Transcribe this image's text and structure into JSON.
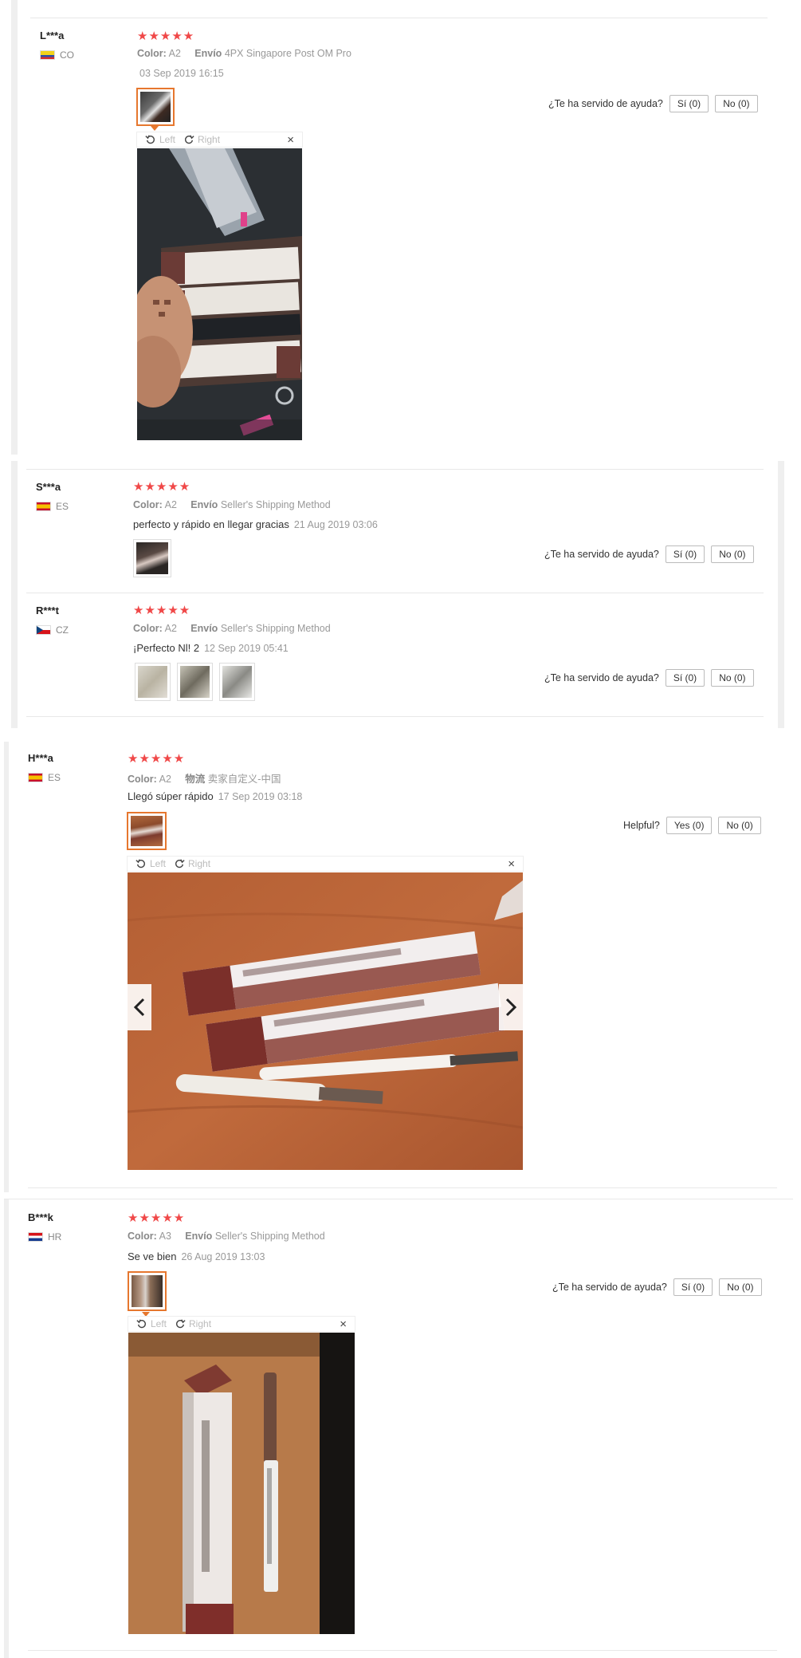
{
  "reviews": [
    {
      "user": "L***a",
      "country": "CO",
      "stars": "★★★★★",
      "color_label": "Color:",
      "color_value": "A2",
      "ship_label": "Envío",
      "ship_value": "4PX Singapore Post OM Pro",
      "date": "03 Sep 2019 16:15",
      "helpful_q": "¿Te ha servido de ayuda?",
      "yes": "Sí (0)",
      "no": "No (0)"
    },
    {
      "user": "S***a",
      "country": "ES",
      "stars": "★★★★★",
      "color_label": "Color:",
      "color_value": "A2",
      "ship_label": "Envío",
      "ship_value": "Seller's Shipping Method",
      "text": "perfecto y rápido en llegar gracias",
      "date": "21 Aug 2019 03:06",
      "helpful_q": "¿Te ha servido de ayuda?",
      "yes": "Sí (0)",
      "no": "No (0)"
    },
    {
      "user": "R***t",
      "country": "CZ",
      "stars": "★★★★★",
      "color_label": "Color:",
      "color_value": "A2",
      "ship_label": "Envío",
      "ship_value": "Seller's Shipping Method",
      "text": "¡Perfecto Nl! 2",
      "date": "12 Sep 2019 05:41",
      "helpful_q": "¿Te ha servido de ayuda?",
      "yes": "Sí (0)",
      "no": "No (0)"
    },
    {
      "user": "H***a",
      "country": "ES",
      "stars": "★★★★★",
      "color_label": "Color:",
      "color_value": "A2",
      "ship_label": "物流",
      "ship_value": "卖家自定义-中国",
      "text": "Llegó súper rápido",
      "date": "17 Sep 2019 03:18",
      "helpful_q": "Helpful?",
      "yes": "Yes (0)",
      "no": "No (0)"
    },
    {
      "user": "B***k",
      "country": "HR",
      "stars": "★★★★★",
      "color_label": "Color:",
      "color_value": "A3",
      "ship_label": "Envío",
      "ship_value": "Seller's Shipping Method",
      "text": "Se ve bien",
      "date": "26 Aug 2019 13:03",
      "helpful_q": "¿Te ha servido de ayuda?",
      "yes": "Sí (0)",
      "no": "No (0)"
    }
  ],
  "viewer": {
    "left": "Left",
    "right": "Right",
    "close": "×"
  },
  "colors": {
    "star": "#f04848",
    "accent": "#e6772e",
    "meta": "#999999"
  }
}
